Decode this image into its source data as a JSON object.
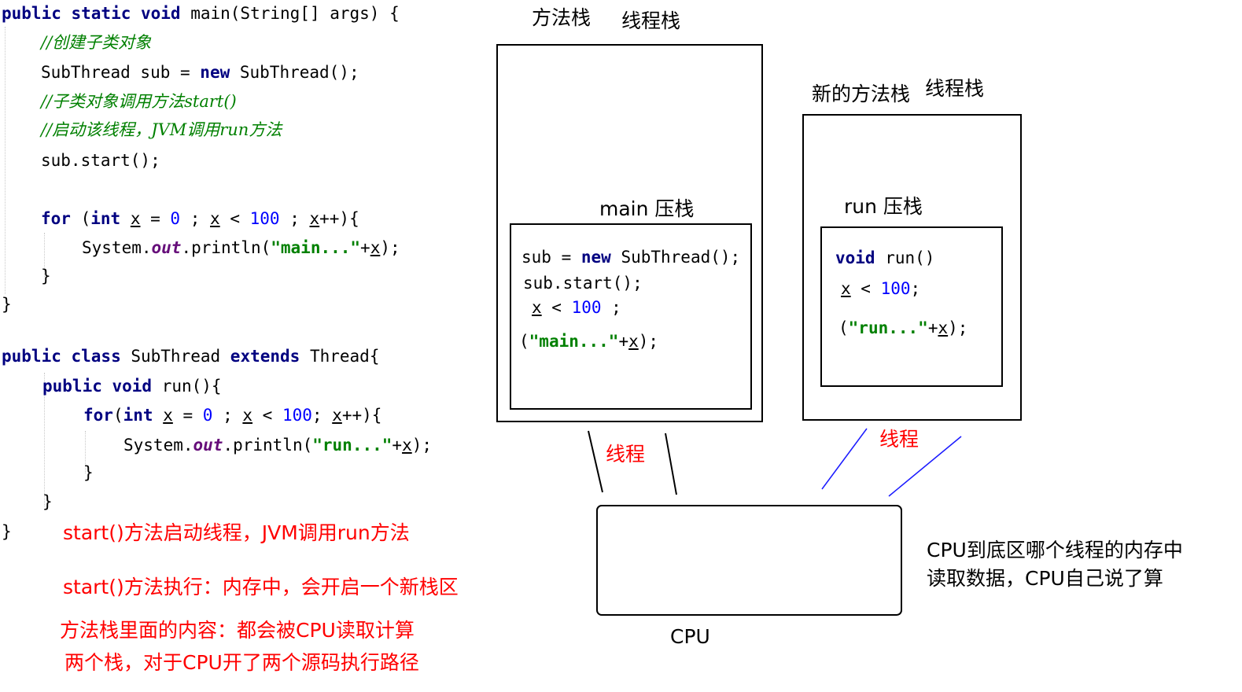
{
  "code": {
    "main_sig": "public static void main(String[] args) {",
    "comment_create": "//创建子类对象",
    "sub_new": "SubThread sub = new SubThread();",
    "comment_start": "//子类对象调用方法start()",
    "comment_jvm": "//启动该线程，JVM调用run方法",
    "sub_start": "sub.start();",
    "for_main": "for (int x = 0 ; x < 100 ; x++){",
    "println_main": "System.out.println(\"main...\"+x);",
    "close_for": "}",
    "close_main": "}",
    "class_sig": "public class SubThread extends Thread{",
    "run_sig": "public void run(){",
    "for_run": "for(int x = 0 ; x < 100; x++){",
    "println_run": "System.out.println(\"run...\"+x);",
    "close_for_run": "}",
    "close_run": "}",
    "close_class": "}"
  },
  "stacks": {
    "left_title_method": "方法栈",
    "left_title_thread": "线程栈",
    "main_push": "main 压栈",
    "main_frame": {
      "line1": "sub = new SubThread();",
      "line2": "sub.start();",
      "line3": "x < 100 ;",
      "line4": "(\"main...\"+x);"
    },
    "right_title_method": "新的方法栈",
    "right_title_thread": "线程栈",
    "run_push": "run 压栈",
    "run_frame": {
      "line1": "void run()",
      "line2": "x < 100;",
      "line3": "(\"run...\"+x);"
    }
  },
  "thread_label_left": "线程",
  "thread_label_right": "线程",
  "cpu_label": "CPU",
  "cpu_note": [
    "CPU到底区哪个线程的内存中",
    "读取数据，CPU自己说了算"
  ],
  "notes": [
    "start()方法启动线程，JVM调用run方法",
    "start()方法执行：内存中，会开启一个新栈区",
    "方法栈里面的内容：都会被CPU读取计算",
    "两个栈，对于CPU开了两个源码执行路径"
  ],
  "colors": {
    "keyword": "#000080",
    "comment": "#008000",
    "number": "#0000ff",
    "string": "#008000",
    "field": "#660e7a",
    "annotation": "#ff0000",
    "thread_line_right": "#0000ff"
  }
}
